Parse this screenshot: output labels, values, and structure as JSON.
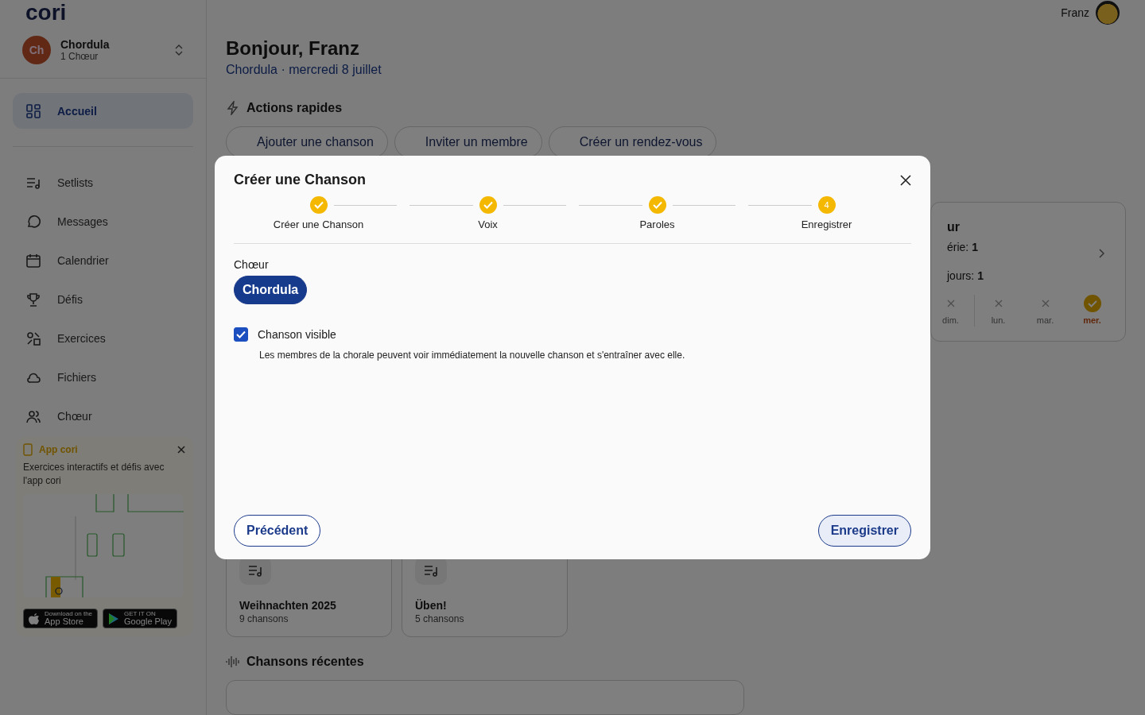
{
  "sidebar": {
    "logo": "cori",
    "choir": {
      "initials": "Ch",
      "name": "Chordula",
      "subtitle": "1 Chœur"
    },
    "nav": [
      {
        "label": "Accueil",
        "selected": true
      },
      {
        "label": "Setlists",
        "selected": false
      },
      {
        "label": "Messages",
        "selected": false
      },
      {
        "label": "Calendrier",
        "selected": false
      },
      {
        "label": "Défis",
        "selected": false
      },
      {
        "label": "Exercices",
        "selected": false
      },
      {
        "label": "Fichiers",
        "selected": false
      },
      {
        "label": "Chœur",
        "selected": false
      }
    ],
    "promo": {
      "title": "App cori",
      "text": "Exercices interactifs et défis avec l'app cori",
      "badges": [
        {
          "small": "Download on the",
          "big": "App Store"
        },
        {
          "small": "GET IT ON",
          "big": "Google Play"
        }
      ]
    }
  },
  "header": {
    "user_name": "Franz"
  },
  "greeting": {
    "title": "Bonjour, Franz",
    "subtitle": "Chordula · mercredi 8 juillet"
  },
  "quick_actions": {
    "title": "Actions rapides",
    "buttons": [
      "Ajouter une chanson",
      "Inviter un membre",
      "Créer un rendez-vous"
    ]
  },
  "streak": {
    "title": "ur",
    "lines": [
      "érie: **1**",
      "jours: **1**"
    ],
    "days": [
      {
        "label": "dim.",
        "done": false
      },
      {
        "label": "lun.",
        "done": false
      },
      {
        "label": "mar.",
        "done": false
      },
      {
        "label": "mer.",
        "done": true
      }
    ]
  },
  "setlists": [
    {
      "name": "Weihnachten 2025",
      "count": "9 chansons"
    },
    {
      "name": "Üben!",
      "count": "5 chansons"
    }
  ],
  "recent": {
    "title": "Chansons récentes"
  },
  "modal": {
    "title": "Créer une Chanson",
    "steps": [
      {
        "label": "Créer une Chanson",
        "done": true
      },
      {
        "label": "Voix",
        "done": true
      },
      {
        "label": "Paroles",
        "done": true
      },
      {
        "label": "Enregistrer",
        "done": false,
        "number": "4"
      }
    ],
    "choir_label": "Chœur",
    "choirs": [
      {
        "label": "Chordula",
        "selected": true
      }
    ],
    "visible": {
      "label": "Chanson visible",
      "checked": true,
      "description": "Les membres de la chorale peuvent voir immédiatement la nouvelle chanson et s'entraîner avec elle."
    },
    "back_button": "Précédent",
    "save_button": "Enregistrer"
  }
}
